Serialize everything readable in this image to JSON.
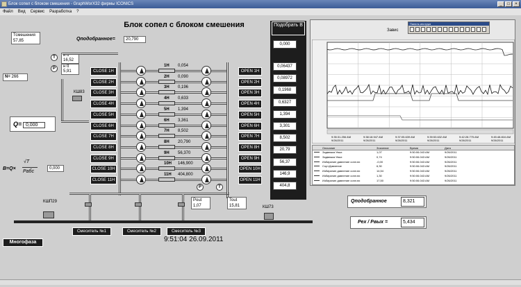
{
  "window": {
    "title": "Блок сопел с блоком смешения - GraphWorX32 фирмы ICONICS",
    "menu": [
      "Файл",
      "Вид",
      "Сервис",
      "Разработка",
      "?"
    ],
    "win_buttons": [
      "_",
      "□",
      "×"
    ]
  },
  "diagram": {
    "title": "Блок сопел с блоком смешения",
    "q_total_label": "Qподобранное=",
    "q_total_value": "20,790",
    "pick_button": "Подобрать В",
    "pick_value": "0,000",
    "t_mix": {
      "label": "Тсмешения",
      "value": "57,85"
    },
    "n_label": "N=",
    "n_value": "266",
    "upstream_t": {
      "label": "н tt",
      "value": "16,52"
    },
    "upstream_p": {
      "label": "н tt",
      "value": "5,91"
    },
    "meter_top": "КШ83",
    "q_label": "Q=",
    "q_value": "0,000",
    "b_formula_lhs": "B=Q×",
    "b_formula_num": "√T",
    "b_formula_den": "Pабс",
    "b_value": "0,000",
    "close_buttons": [
      "CLOSE 1H",
      "CLOSE 2H",
      "CLOSE 3H",
      "CLOSE 4H",
      "CLOSE 5H",
      "CLOSE 6H",
      "CLOSE 7H",
      "CLOSE 8H",
      "CLOSE 9H",
      "CLOSE 10H",
      "CLOSE 11H"
    ],
    "open_buttons": [
      "OPEN 1H",
      "OPEN 2H",
      "OPEN 3H",
      "OPEN 4H",
      "OPEN 5H",
      "OPEN 6H",
      "OPEN 7H",
      "OPEN 8H",
      "OPEN 9H",
      "OPEN 10H",
      "OPEN 11H"
    ],
    "nozzles": [
      {
        "name": "1H",
        "value": "0,054"
      },
      {
        "name": "2H",
        "value": "0,090"
      },
      {
        "name": "3H",
        "value": "0,196"
      },
      {
        "name": "4H",
        "value": "0,633"
      },
      {
        "name": "5H",
        "value": "1,394"
      },
      {
        "name": "6H",
        "value": "3,361"
      },
      {
        "name": "7H",
        "value": "8,502"
      },
      {
        "name": "8H",
        "value": "20,790"
      },
      {
        "name": "9H",
        "value": "56,370"
      },
      {
        "name": "10H",
        "value": "146,900"
      },
      {
        "name": "11H",
        "value": "404,800"
      }
    ],
    "column_values": [
      "0,06437",
      "0,08972",
      "0,1968",
      "0,6327",
      "1,394",
      "3,301",
      "8,502",
      "20,79",
      "56,37",
      "146,9",
      "404,8"
    ],
    "p_out": {
      "label": "Pout",
      "value": "1,07"
    },
    "t_out": {
      "label": "Tout",
      "value": "15,81"
    },
    "p_sym": "P",
    "t_sym": "T",
    "meter_left": "КШП29",
    "meter_right": "КШ73",
    "mixers": [
      "Смеситель №1",
      "Смеситель №2",
      "Смеситель №3"
    ],
    "multiphase": "Многофаза",
    "datetime": "9:51:04 26.09.2011",
    "q_picked_label": "Qподобранное",
    "q_picked_value": "8,321",
    "ratio_label": "Pex / Pвых =",
    "ratio_value": "5,434"
  },
  "trend": {
    "header": "Завис",
    "toolbar_title": "Панель инструм",
    "x_ticks": [
      "9:35:31.256 AM\n9/26/2011",
      "9:38:18.947 AM\n9/26/2011",
      "9:37:05.639 AM\n9/26/2011",
      "9:39:53.632 AM\n9/26/2011",
      "9:42:28.775 AM\n9/26/2011",
      "9:45:48.816 AM\n9/26/2011"
    ],
    "legend_headers": [
      "Описание",
      "Значение",
      "Время",
      "Дата"
    ],
    "legend_rows": [
      [
        "Задвижка Увых",
        "1,07",
        "9:50:06.043 AM",
        "9/26/2011"
      ],
      [
        "Задвижка Увых",
        "0,74",
        "9:50:06.043 AM",
        "9/26/2011"
      ],
      [
        "Избирание давление сопл.вх",
        "-0,00",
        "9:50:06.043 AM",
        "9/26/2011"
      ],
      [
        "Сорт.Давление",
        "6,30",
        "9:50:06.043 AM",
        "9/26/2011"
      ],
      [
        "Избирание давление сопл.вх",
        "14,54",
        "9:50:06.043 AM",
        "9/26/2011"
      ],
      [
        "Избирание давление сопл.вх",
        "1,30",
        "9:50:06.043 AM",
        "9/26/2011"
      ],
      [
        "Избирание давление сопл.вх",
        "17,50",
        "9:50:06.043 AM",
        "9/26/2011"
      ]
    ]
  }
}
